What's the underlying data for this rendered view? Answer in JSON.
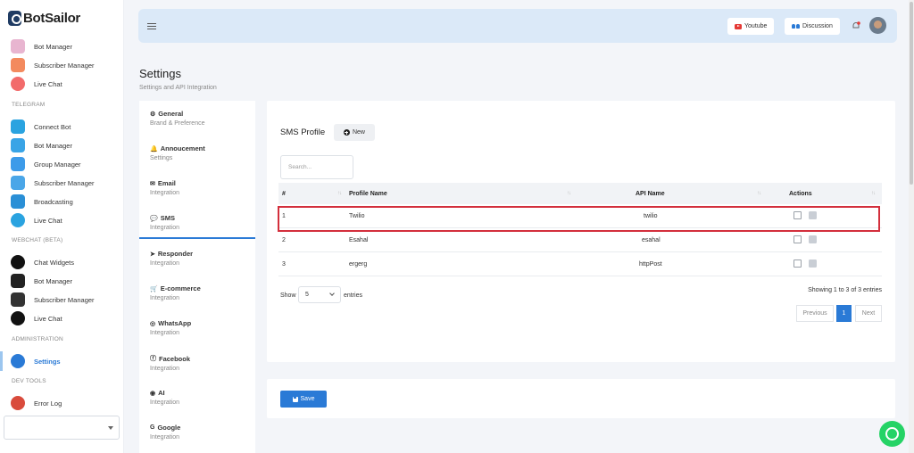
{
  "brand": {
    "name": "BotSailor"
  },
  "sidebar": {
    "messenger_items": [
      {
        "label": "Bot Manager",
        "icon": "messenger-bot-icon",
        "color": "#e8b5d0"
      },
      {
        "label": "Subscriber Manager",
        "icon": "messenger-subscriber-icon",
        "color": "#f38a5e"
      },
      {
        "label": "Live Chat",
        "icon": "messenger-livechat-icon",
        "color": "#f26b6b"
      }
    ],
    "sections": {
      "telegram": "TELEGRAM",
      "webchat": "WEBCHAT (BETA)",
      "administration": "ADMINISTRATION",
      "devtools": "DEV TOOLS"
    },
    "telegram_items": [
      {
        "label": "Connect Bot",
        "icon": "telegram-icon",
        "color": "#2aa3e0"
      },
      {
        "label": "Bot Manager",
        "icon": "telegram-bot-icon",
        "color": "#39a4e6"
      },
      {
        "label": "Group Manager",
        "icon": "group-icon",
        "color": "#3d9be9"
      },
      {
        "label": "Subscriber Manager",
        "icon": "telegram-subscriber-icon",
        "color": "#4aa6e8"
      },
      {
        "label": "Broadcasting",
        "icon": "broadcast-icon",
        "color": "#2a8fd6"
      },
      {
        "label": "Live Chat",
        "icon": "telegram-livechat-icon",
        "color": "#2aa3e0"
      }
    ],
    "webchat_items": [
      {
        "label": "Chat Widgets",
        "icon": "chat-widget-icon",
        "color": "#111111"
      },
      {
        "label": "Bot Manager",
        "icon": "webchat-bot-icon",
        "color": "#222222"
      },
      {
        "label": "Subscriber Manager",
        "icon": "webchat-subscriber-icon",
        "color": "#333333"
      },
      {
        "label": "Live Chat",
        "icon": "webchat-livechat-icon",
        "color": "#111111"
      }
    ],
    "admin_items": [
      {
        "label": "Settings",
        "icon": "settings-gear-icon",
        "color": "#2a7ad6"
      }
    ],
    "devtools_items": [
      {
        "label": "Error Log",
        "icon": "bug-icon",
        "color": "#d94b3c"
      }
    ]
  },
  "topbar": {
    "youtube_label": "Youtube",
    "discussion_label": "Discussion"
  },
  "page": {
    "title": "Settings",
    "subtitle": "Settings and API Integration"
  },
  "settings_nav": [
    {
      "title": "General",
      "sub": "Brand & Preference",
      "glyph": "⚙"
    },
    {
      "title": "Annoucement",
      "sub": "Settings",
      "glyph": "🔔"
    },
    {
      "title": "Email",
      "sub": "Integration",
      "glyph": "✉"
    },
    {
      "title": "SMS",
      "sub": "Integration",
      "glyph": "💬"
    },
    {
      "title": "Responder",
      "sub": "Integration",
      "glyph": "➤"
    },
    {
      "title": "E-commerce",
      "sub": "Integration",
      "glyph": "🛒"
    },
    {
      "title": "WhatsApp",
      "sub": "Integration",
      "glyph": "◎"
    },
    {
      "title": "Facebook",
      "sub": "Integration",
      "glyph": "ⓕ"
    },
    {
      "title": "AI",
      "sub": "Integration",
      "glyph": "◉"
    },
    {
      "title": "Google",
      "sub": "Integration",
      "glyph": "G"
    }
  ],
  "sms_profile": {
    "title": "SMS Profile",
    "new_label": "New",
    "search_placeholder": "Search...",
    "columns": [
      "#",
      "Profile Name",
      "API Name",
      "Actions"
    ],
    "rows": [
      {
        "num": "1",
        "profile": "Twilio",
        "api": "twilio"
      },
      {
        "num": "2",
        "profile": "Esahal",
        "api": "esahal"
      },
      {
        "num": "3",
        "profile": "ergerg",
        "api": "httpPost"
      }
    ],
    "show_label": "Show",
    "entries_value": "5",
    "entries_label": "entries",
    "showing_text": "Showing 1 to 3 of 3 entries",
    "pagination": {
      "previous": "Previous",
      "current": "1",
      "next": "Next"
    }
  },
  "save_label": "Save"
}
